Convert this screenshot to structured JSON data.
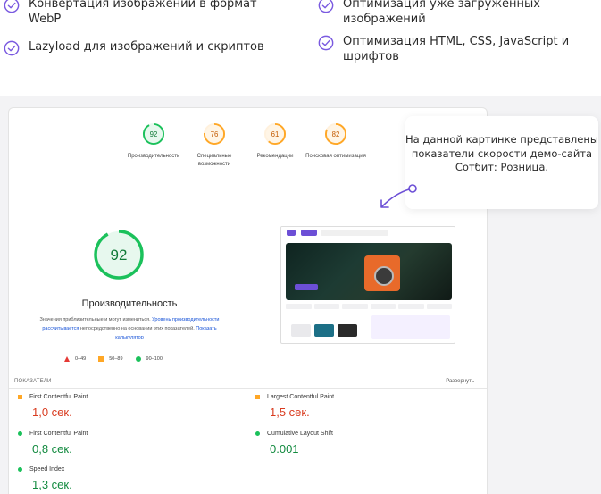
{
  "features": [
    "Конвертация изображений в формат WebP",
    "Оптимизация уже загруженных изображений",
    "Lazyload для изображений и скриптов",
    "Оптимизация HTML, CSS, JavaScript и шрифтов"
  ],
  "colors": {
    "accent": "#6c4fd6",
    "pass": "#1bc15b",
    "average": "#ffa726",
    "fail": "#e53935"
  },
  "gauges": [
    {
      "score": "92",
      "label": "Производительность",
      "level": "pass"
    },
    {
      "score": "76",
      "label": "Специальные возможности",
      "level": "average"
    },
    {
      "score": "61",
      "label": "Рекомендации",
      "level": "average"
    },
    {
      "score": "82",
      "label": "Поисковая оптимизация",
      "level": "average"
    }
  ],
  "performance": {
    "score": "92",
    "score_fraction": 0.92,
    "title": "Производительность",
    "desc_1": "Значения приблизительные и могут измениться. ",
    "link_1": "Уровень производительности рассчитывается",
    "desc_2": " непосредственно на основании этих показателей. ",
    "link_2": "Показать калькулятор"
  },
  "legend": [
    {
      "icon": "triangle-icon",
      "label": "0–49"
    },
    {
      "icon": "square-icon",
      "label": "50–89"
    },
    {
      "icon": "circle-icon",
      "label": "90–100"
    }
  ],
  "metrics_header": {
    "label": "ПОКАЗАТЕЛИ",
    "expand": "Развернуть"
  },
  "metrics": [
    {
      "name": "First Contentful Paint",
      "value": "1,0 сек.",
      "status": "average",
      "color": "red"
    },
    {
      "name": "Largest Contentful Paint",
      "value": "1,5 сек.",
      "status": "average",
      "color": "red"
    },
    {
      "name": "First Contentful Paint",
      "value": "0,8 сек.",
      "status": "pass",
      "color": "green"
    },
    {
      "name": "Cumulative Layout Shift",
      "value": "0.001",
      "status": "pass",
      "color": "green"
    },
    {
      "name": "Speed Index",
      "value": "1,3 сек.",
      "status": "pass",
      "color": "green"
    }
  ],
  "tooltip": "На данной картинке представлены показатели скорости демо-сайта Сотбит: Розница."
}
